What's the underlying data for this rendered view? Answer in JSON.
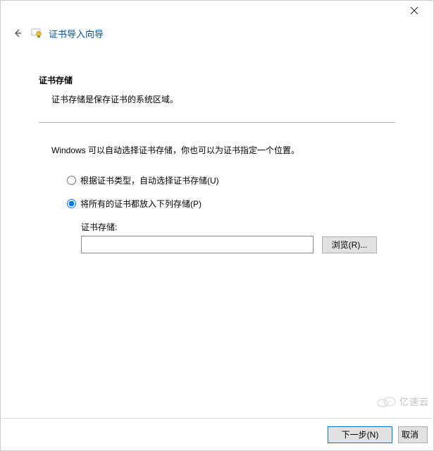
{
  "window": {
    "wizard_title": "证书导入向导"
  },
  "section": {
    "heading": "证书存储",
    "desc": "证书存储是保存证书的系统区域。"
  },
  "prompt": "Windows 可以自动选择证书存储，你也可以为证书指定一个位置。",
  "radios": {
    "auto_label": "根据证书类型，自动选择证书存储(U)",
    "manual_label": "将所有的证书都放入下列存储(P)"
  },
  "store": {
    "label": "证书存储:",
    "value": "",
    "browse_label": "浏览(R)..."
  },
  "footer": {
    "next_label": "下一步(N)",
    "cancel_label": "取消"
  },
  "watermark": {
    "text": "亿速云"
  }
}
